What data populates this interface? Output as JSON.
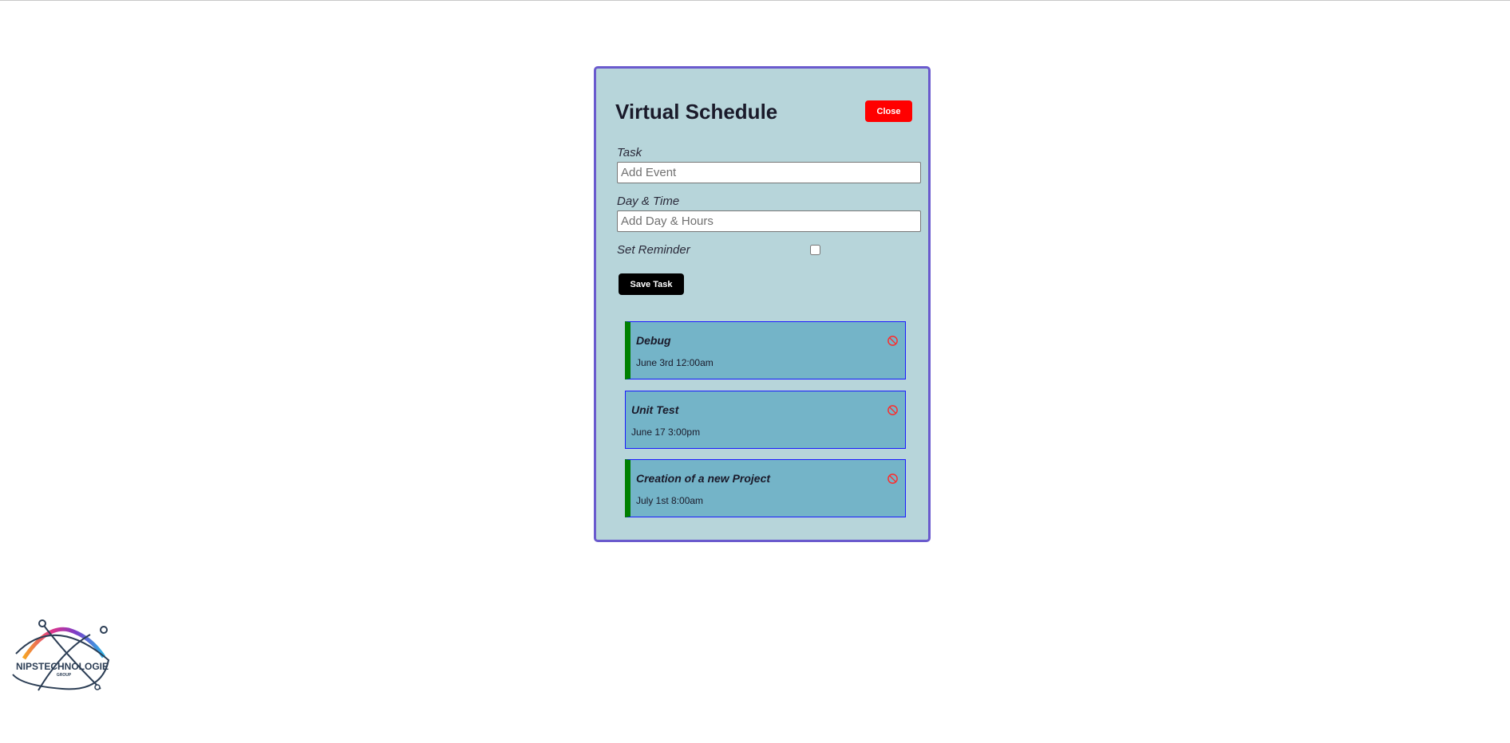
{
  "app": {
    "title": "Virtual Schedule",
    "close_label": "Close"
  },
  "form": {
    "task_label": "Task",
    "task_placeholder": "Add Event",
    "task_value": "",
    "day_label": "Day & Time",
    "day_placeholder": "Add Day & Hours",
    "day_value": "",
    "reminder_label": "Set Reminder",
    "reminder_checked": false,
    "save_label": "Save Task"
  },
  "tasks": [
    {
      "name": "Debug",
      "time": "June 3rd 12:00am",
      "reminder": true
    },
    {
      "name": "Unit Test",
      "time": "June 17 3:00pm",
      "reminder": false
    },
    {
      "name": "Creation of a new Project",
      "time": "July 1st 8:00am",
      "reminder": true
    }
  ],
  "icons": {
    "delete": "delete-circle-slash-icon"
  },
  "colors": {
    "panel_bg": "#b7d5da",
    "panel_border": "#6a5acd",
    "task_bg": "#74b4c8",
    "reminder_bar": "#008000",
    "close_btn": "#ff0000",
    "save_btn": "#000000"
  },
  "logo": {
    "text": "NIPSTECHNOLOGIE",
    "subtext": "GROUP"
  }
}
